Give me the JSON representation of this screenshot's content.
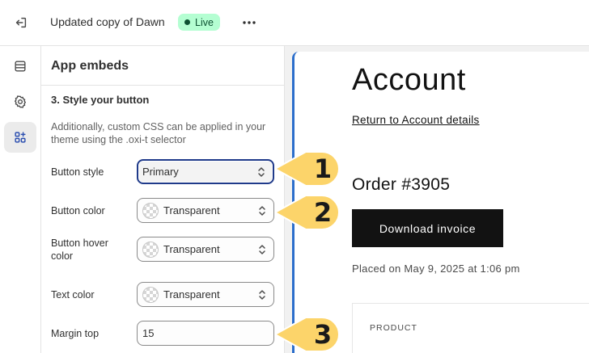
{
  "topbar": {
    "theme_name": "Updated copy of Dawn",
    "status_badge": "Live"
  },
  "panel": {
    "title": "App embeds",
    "section_title": "3. Style your button",
    "help_text": "Additionally, custom CSS can be applied in your theme using the .oxi-t selector",
    "fields": {
      "button_style": {
        "label": "Button style",
        "value": "Primary"
      },
      "button_color": {
        "label": "Button color",
        "value": "Transparent"
      },
      "button_hover_color": {
        "label": "Button hover color",
        "value": "Transparent"
      },
      "text_color": {
        "label": "Text color",
        "value": "Transparent"
      },
      "margin_top": {
        "label": "Margin top",
        "value": "15"
      }
    }
  },
  "preview": {
    "page_title": "Account",
    "return_link": "Return to Account details",
    "order_title": "Order #3905",
    "download_button": "Download invoice",
    "placed_on": "Placed on May 9, 2025 at 1:06 pm",
    "table_header_product": "PRODUCT"
  },
  "callouts": [
    "1",
    "2",
    "3"
  ],
  "colors": {
    "accent": "#2c6ecb",
    "focus_border": "#1f3a8a",
    "live_badge_bg": "#b4fed2",
    "callout_yellow": "#fcd46a",
    "button_dark": "#121212"
  },
  "icons": {
    "exit": "exit-icon",
    "more": "more-horizontal-icon",
    "rail_sections": "sections-icon",
    "rail_settings": "gear-icon",
    "rail_apps": "apps-icon",
    "select_chevron": "select-chevron-icon"
  }
}
